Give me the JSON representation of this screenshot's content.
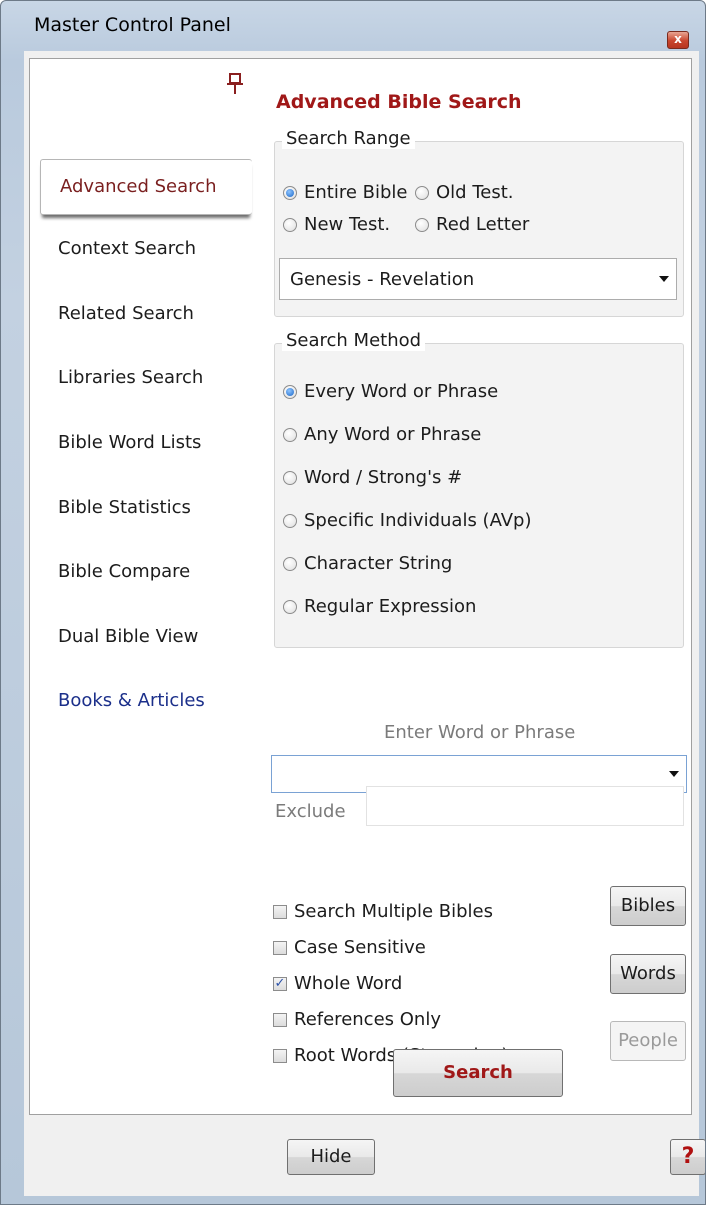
{
  "window": {
    "title": "Master Control Panel",
    "close_glyph": "x"
  },
  "tabs": [
    {
      "label": "Advanced Search"
    },
    {
      "label": "Context Search"
    },
    {
      "label": "Related Search"
    },
    {
      "label": "Libraries Search"
    },
    {
      "label": "Bible Word Lists"
    },
    {
      "label": "Bible Statistics"
    },
    {
      "label": "Bible Compare"
    },
    {
      "label": "Dual Bible View"
    },
    {
      "label": "Books & Articles"
    }
  ],
  "search": {
    "heading": "Advanced Bible Search",
    "range": {
      "title": "Search Range",
      "options": [
        "Entire Bible",
        "Old Test.",
        "New Test.",
        "Red Letter"
      ],
      "selected": "Entire Bible",
      "books_value": "Genesis - Revelation"
    },
    "method": {
      "title": "Search Method",
      "options": [
        "Every Word or Phrase",
        "Any Word or Phrase",
        "Word / Strong's #",
        "Specific Individuals (AVp)",
        "Character String",
        "Regular Expression"
      ],
      "selected": "Every Word or Phrase"
    },
    "phrase_label": "Enter Word or Phrase",
    "phrase_value": "",
    "exclude_label": "Exclude",
    "exclude_value": "",
    "options": [
      {
        "label": "Search Multiple Bibles",
        "checked": false
      },
      {
        "label": "Case Sensitive",
        "checked": false
      },
      {
        "label": "Whole Word",
        "checked": true
      },
      {
        "label": "References Only",
        "checked": false
      },
      {
        "label": "Root Words (Stemming)",
        "checked": false
      }
    ],
    "buttons": {
      "bibles": "Bibles",
      "words": "Words",
      "people": "People",
      "search": "Search"
    }
  },
  "footer": {
    "hide": "Hide",
    "help": "?"
  },
  "icons": {
    "pin": "pin-icon",
    "close": "close-icon",
    "dropdown": "chevron-down-icon"
  },
  "colors": {
    "accent": "#a01818",
    "link": "#1b2f8a"
  }
}
